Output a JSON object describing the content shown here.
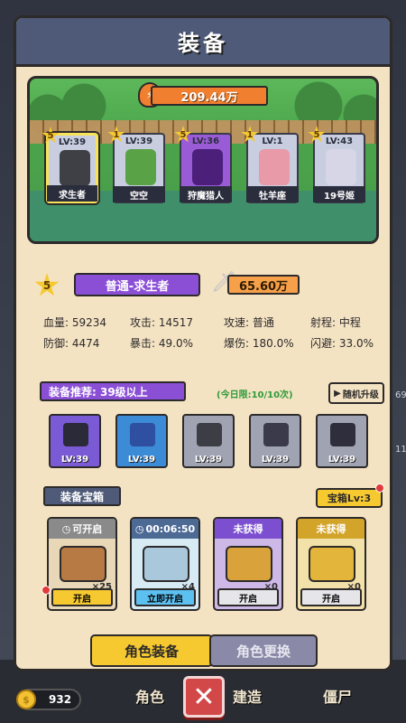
{
  "title": "装备",
  "total_power": "209.44万",
  "heroes": [
    {
      "stars": "5",
      "level": "LV:39",
      "name": "求生者",
      "color": "#c8cde0",
      "sprite": "#3f3f46",
      "selected": true
    },
    {
      "stars": "1",
      "level": "LV:39",
      "name": "空空",
      "color": "#c8cde0",
      "sprite": "#5aa246",
      "selected": false
    },
    {
      "stars": "5",
      "level": "LV:36",
      "name": "狩魔猎人",
      "color": "#9a5cd6",
      "sprite": "#4b1f7a",
      "selected": false
    },
    {
      "stars": "1",
      "level": "LV:1",
      "name": "牡羊座",
      "color": "#c8cde0",
      "sprite": "#e89aa8",
      "selected": false
    },
    {
      "stars": "5",
      "level": "LV:43",
      "name": "19号姬",
      "color": "#c8cde0",
      "sprite": "#d6d6e6",
      "selected": false
    }
  ],
  "character": {
    "stars": "5",
    "name": "普通-求生者",
    "power": "65.60万"
  },
  "stats": [
    "血量: 59234",
    "攻击: 14517",
    "攻速: 普通",
    "射程: 中程",
    "防御: 4474",
    "暴击: 49.0%",
    "爆伤: 180.0%",
    "闪避: 33.0%"
  ],
  "recommend": {
    "label": "装备推荐: 39级以上",
    "daily_limit": "(今日限:10/10次)",
    "random_button": "随机升级"
  },
  "equipment": [
    {
      "level": "LV:39",
      "icon": "pistol-icon",
      "rarity": "purple"
    },
    {
      "level": "LV:39",
      "icon": "armor-icon",
      "rarity": "blue"
    },
    {
      "level": "LV:39",
      "icon": "pants-icon",
      "rarity": "gray"
    },
    {
      "level": "LV:39",
      "icon": "gauntlet-icon",
      "rarity": "gray"
    },
    {
      "level": "LV:39",
      "icon": "boots-icon",
      "rarity": "gray"
    }
  ],
  "chest_section": {
    "title": "装备宝箱",
    "level_button": "宝箱Lv:3"
  },
  "chests": [
    {
      "status": "可开启",
      "count": "×25",
      "button": "开启",
      "class": "c1",
      "body": "#b77a44"
    },
    {
      "status": "00:06:50",
      "count": "×4",
      "button": "立即开启",
      "class": "c2",
      "body": "#a9c8dc"
    },
    {
      "status": "未获得",
      "count": "×0",
      "button": "开启",
      "class": "c3",
      "body": "#d9a23a"
    },
    {
      "status": "未获得",
      "count": "×0",
      "button": "开启",
      "class": "c4",
      "body": "#e3b53b"
    }
  ],
  "tabs": {
    "active": "角色装备",
    "inactive": "角色更换"
  },
  "background": {
    "coins": "932",
    "tab_role": "角色",
    "tab_build": "建造",
    "tab_zombie": "僵尸",
    "side_num_1": "69",
    "side_num_2": "11"
  }
}
